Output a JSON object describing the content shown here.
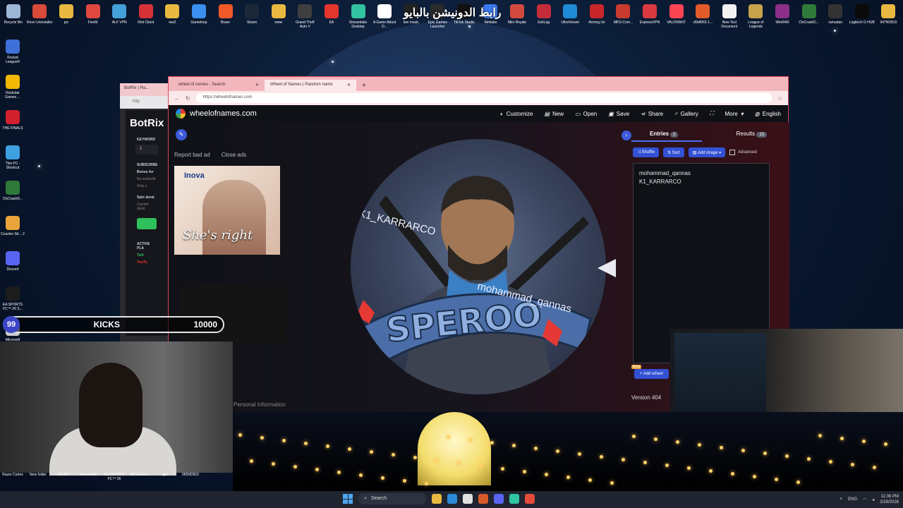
{
  "desktop": {
    "top_icons": [
      {
        "label": "Recycle Bin",
        "color": "#9fb7d6"
      },
      {
        "label": "Revo Uninstaller",
        "color": "#d84a3a"
      },
      {
        "label": "pic",
        "color": "#e8b840"
      },
      {
        "label": "FiveM",
        "color": "#e0473f"
      },
      {
        "label": "ALF VPN",
        "color": "#44a0d8"
      },
      {
        "label": "Riot Client",
        "color": "#d63238"
      },
      {
        "label": "ww2",
        "color": "#e8b840"
      },
      {
        "label": "Gameloop",
        "color": "#3a8ff0"
      },
      {
        "label": "Brave",
        "color": "#f05a28"
      },
      {
        "label": "Steam",
        "color": "#1b2838"
      },
      {
        "label": "www",
        "color": "#e8b840"
      },
      {
        "label": "Grand Theft Auto V",
        "color": "#3f3f3f"
      },
      {
        "label": "EA",
        "color": "#e5362d"
      },
      {
        "label": "Streamlabs Desktop",
        "color": "#31c3a2"
      },
      {
        "label": "A Game About D...",
        "color": "#ffffff"
      },
      {
        "label": "live music",
        "color": "#222222"
      },
      {
        "label": "Epic Games Launcher",
        "color": "#2b2b2b"
      },
      {
        "label": "TikTok Studio",
        "color": "#111111"
      },
      {
        "label": "Aimlabs",
        "color": "#3b78f0"
      },
      {
        "label": "Mini Royale",
        "color": "#d24a3f"
      },
      {
        "label": "ExitLag",
        "color": "#c42c3a"
      },
      {
        "label": "UltraViewer",
        "color": "#1f8ad6"
      },
      {
        "label": "Among Us",
        "color": "#c8262a"
      },
      {
        "label": "MKS-Com...",
        "color": "#c83b2e"
      },
      {
        "label": "ExpressVPN",
        "color": "#da3940"
      },
      {
        "label": "VALORANT",
        "color": "#fa4454"
      },
      {
        "label": "cf9df962-1...",
        "color": "#e05a2a"
      },
      {
        "label": "New Text Document",
        "color": "#f2f2f2"
      },
      {
        "label": "League of Legends",
        "color": "#c8a14b"
      },
      {
        "label": "WinRAR",
        "color": "#8b2f88"
      },
      {
        "label": "CfxCrashD...",
        "color": "#2f7a3a"
      },
      {
        "label": "ramadan",
        "color": "#333333"
      },
      {
        "label": "Logitech G HUB",
        "color": "#0a0a0a"
      },
      {
        "label": "947ND810",
        "color": "#e8b840"
      }
    ],
    "left_icons": [
      {
        "label": "Rocket League®",
        "color": "#3f6fd8"
      },
      {
        "label": "Rockstar Games ...",
        "color": "#f2b705"
      },
      {
        "label": "THE FINALS",
        "color": "#d2202f"
      },
      {
        "label": "This PC - Shortcut",
        "color": "#3fa0e0"
      },
      {
        "label": "CfxCrashD...",
        "color": "#2f7a3a"
      },
      {
        "label": "Counter-Str... 2",
        "color": "#e8a33a"
      },
      {
        "label": "Discord",
        "color": "#5865f2"
      },
      {
        "label": "EA SPORTS FC™ 26 S...",
        "color": "#1c1c1c"
      },
      {
        "label": "Microsoft",
        "color": "#cccccc"
      }
    ],
    "overlay_text": "رابط الدونيشن بالبايو"
  },
  "bg_browser": {
    "tab_label": "BotRix | Ra...",
    "url": "http",
    "logo": "BotRix",
    "keyword_label": "KEYWORD",
    "keyword_value": "1",
    "subscribe_label": "SUBSCRIBE",
    "bonus_label": "Bonus for",
    "bonus_sub": "No subscrib",
    "only_label": "Only s",
    "spin_label": "Spin durat",
    "spin_sub": "Current durat",
    "active_label": "ACTIVE PLA",
    "twitch": "Twit",
    "youtube": "YouTu"
  },
  "browser": {
    "tabs": [
      {
        "label": "wheel of names - Search",
        "active": false
      },
      {
        "label": "Wheel of Names | Random name",
        "active": true
      }
    ],
    "new_tab": "+",
    "url": "https://wheelofnames.com",
    "site": {
      "brand": "wheelofnames.com",
      "nav": [
        {
          "label": "Customize",
          "icon": "palette-icon"
        },
        {
          "label": "New",
          "icon": "file-icon"
        },
        {
          "label": "Open",
          "icon": "folder-icon"
        },
        {
          "label": "Save",
          "icon": "save-icon"
        },
        {
          "label": "Share",
          "icon": "share-icon"
        },
        {
          "label": "Gallery",
          "icon": "search-icon"
        },
        {
          "label": "",
          "icon": "fullscreen-icon"
        },
        {
          "label": "More",
          "icon": "chevron-down-icon"
        },
        {
          "label": "English",
          "icon": "globe-icon"
        }
      ],
      "report_ad": "Report bad ad",
      "close_ads": "Close ads",
      "ad_brand": "Inova",
      "ad_slogan": "She's right",
      "personal_info": "Personal Information",
      "wheel_logo": "SPEROO",
      "wheel_names": [
        "mohammad_qannas",
        "K1_KARRARCO"
      ],
      "panel": {
        "entries_label": "Entries",
        "entries_count": "2",
        "results_label": "Results",
        "results_count": "13",
        "shuffle": "Shuffle",
        "sort": "Sort",
        "add_image": "Add image",
        "advanced": "Advanced",
        "entries": [
          "mohammad_qannas",
          "K1_KARRARCO"
        ],
        "beta": "Beta",
        "add_wheel": "Add wheel",
        "version": "Version 404"
      }
    }
  },
  "kick_overlay": {
    "number": "99",
    "label": "KICKS",
    "total": "10000",
    "accent": "#3a45c8"
  },
  "bottom_desktop_icons": [
    "Razer Cortex",
    "New folder",
    "FACEIT",
    "New folder",
    "EA SPORTS FC™ 26",
    "MKS-Com...",
    "gta",
    "985ND810"
  ],
  "taskbar": {
    "search_placeholder": "Search",
    "lang": "ENG",
    "time": "11:36 PM",
    "date": "2/28/2026"
  }
}
